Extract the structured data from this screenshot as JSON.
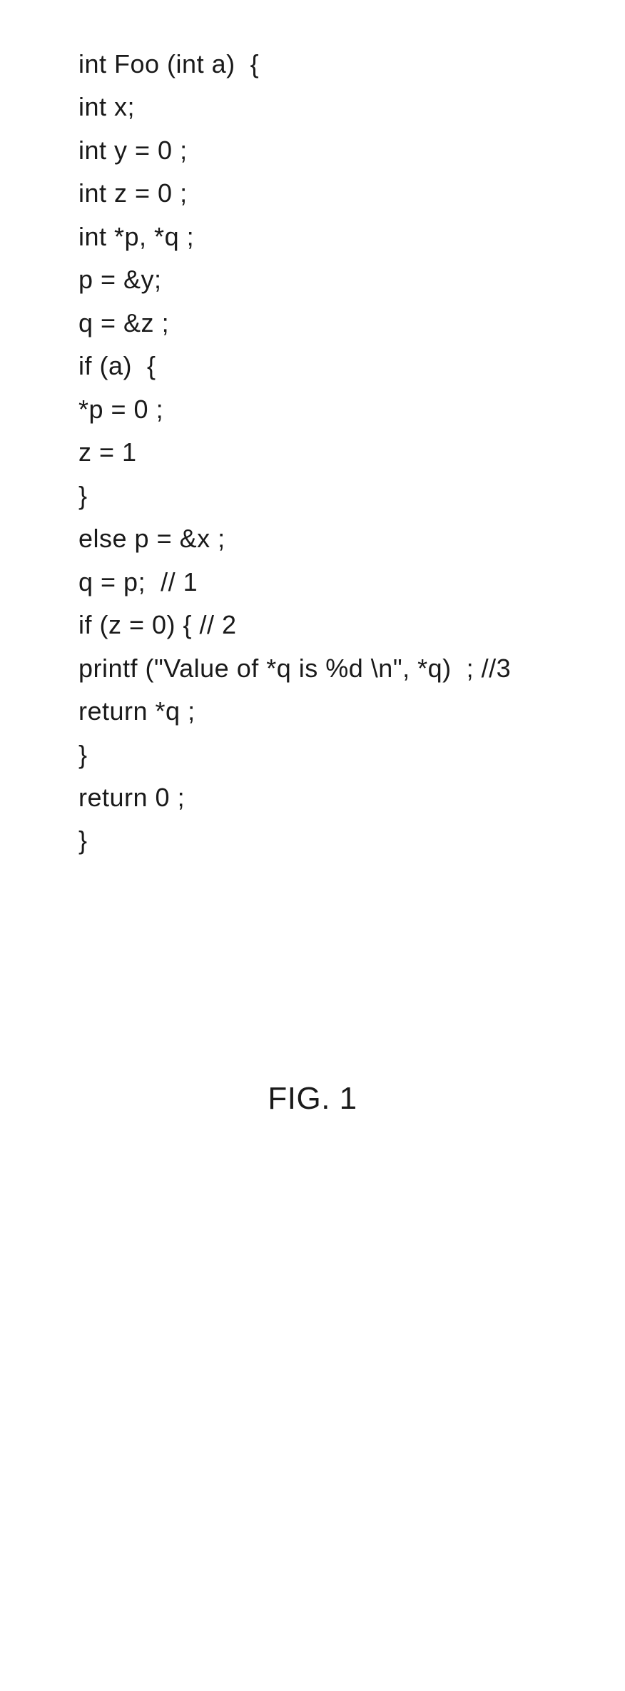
{
  "code": {
    "lines": [
      "int Foo (int a)  {",
      "",
      "int x;",
      "int y = 0 ;",
      "int z = 0 ;",
      "int *p, *q ;",
      "p = &y;",
      "q = &z ;",
      "if (a)  {",
      "*p = 0 ;",
      "z = 1",
      "}",
      "else p = &x ;",
      "q = p;  // 1",
      "if (z = 0) { // 2",
      "printf (\"Value of *q is %d \\n\", *q)  ; //3",
      "return *q ;",
      "}",
      "return 0 ;",
      "}"
    ]
  },
  "figure_label": "FIG. 1"
}
